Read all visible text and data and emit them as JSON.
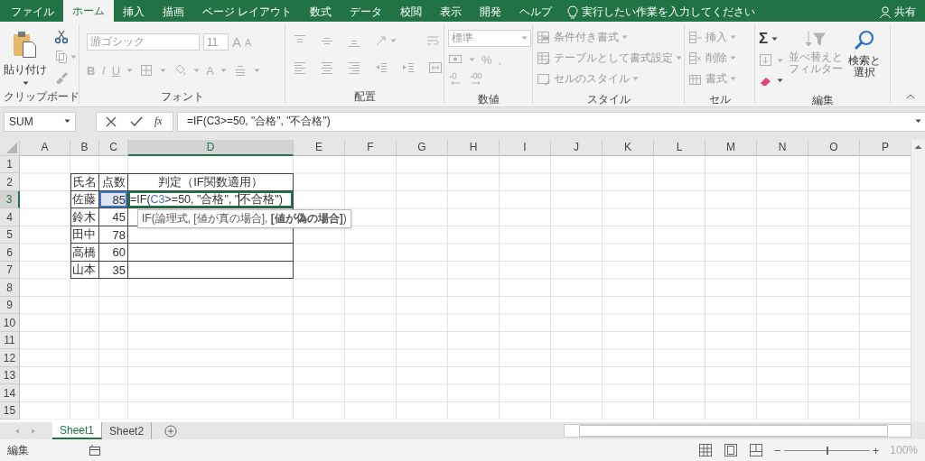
{
  "ribbon_tabs": [
    {
      "label": "ファイル",
      "selected": false
    },
    {
      "label": "ホーム",
      "selected": true
    },
    {
      "label": "挿入",
      "selected": false
    },
    {
      "label": "描画",
      "selected": false
    },
    {
      "label": "ページ レイアウト",
      "selected": false
    },
    {
      "label": "数式",
      "selected": false
    },
    {
      "label": "データ",
      "selected": false
    },
    {
      "label": "校閲",
      "selected": false
    },
    {
      "label": "表示",
      "selected": false
    },
    {
      "label": "開発",
      "selected": false
    },
    {
      "label": "ヘルプ",
      "selected": false
    }
  ],
  "tell_me": "実行したい作業を入力してください",
  "share": "共有",
  "clipboard": {
    "paste": "貼り付け",
    "label": "クリップボード"
  },
  "font": {
    "disabled": true,
    "name": "游ゴシック",
    "size": "11",
    "grow": "A",
    "shrink": "A",
    "bold": "B",
    "italic": "I",
    "underline": "U",
    "font_color": "A",
    "label": "フォント"
  },
  "alignment": {
    "disabled": true,
    "label": "配置"
  },
  "number": {
    "disabled": true,
    "format": "標準",
    "percent": "%",
    "comma": ",",
    "label": "数値"
  },
  "styles": {
    "disabled": true,
    "items": [
      "条件付き書式",
      "テーブルとして書式設定",
      "セルのスタイル"
    ],
    "label": "スタイル"
  },
  "cells": {
    "disabled": true,
    "items": [
      "挿入",
      "削除",
      "書式"
    ],
    "label": "セル"
  },
  "editing": {
    "autosum": "Σ",
    "sort": {
      "lines": [
        "並べ替えと",
        "フィルター"
      ],
      "disabled": true
    },
    "find": {
      "lines": [
        "検索と",
        "選択"
      ],
      "disabled": false
    },
    "label": "編集"
  },
  "formula_bar": {
    "name_box": "SUM",
    "function_button": "fx",
    "formula": "=IF(C3>=50, \"合格\", \"不合格\")"
  },
  "columns": [
    {
      "label": "A",
      "selected": false
    },
    {
      "label": "B",
      "selected": false
    },
    {
      "label": "C",
      "selected": false
    },
    {
      "label": "D",
      "selected": true
    },
    {
      "label": "E",
      "selected": false
    },
    {
      "label": "F",
      "selected": false
    },
    {
      "label": "G",
      "selected": false
    },
    {
      "label": "H",
      "selected": false
    },
    {
      "label": "I",
      "selected": false
    },
    {
      "label": "J",
      "selected": false
    },
    {
      "label": "K",
      "selected": false
    },
    {
      "label": "L",
      "selected": false
    },
    {
      "label": "M",
      "selected": false
    },
    {
      "label": "N",
      "selected": false
    },
    {
      "label": "O",
      "selected": false
    },
    {
      "label": "P",
      "selected": false
    }
  ],
  "rows": [
    {
      "label": "1",
      "selected": false
    },
    {
      "label": "2",
      "selected": false
    },
    {
      "label": "3",
      "selected": true
    },
    {
      "label": "4",
      "selected": false
    },
    {
      "label": "5",
      "selected": false
    },
    {
      "label": "6",
      "selected": false
    },
    {
      "label": "7",
      "selected": false
    },
    {
      "label": "8",
      "selected": false
    },
    {
      "label": "9",
      "selected": false
    },
    {
      "label": "10",
      "selected": false
    },
    {
      "label": "11",
      "selected": false
    },
    {
      "label": "12",
      "selected": false
    },
    {
      "label": "13",
      "selected": false
    },
    {
      "label": "14",
      "selected": false
    },
    {
      "label": "15",
      "selected": false
    }
  ],
  "table": {
    "header": [
      "氏名",
      "点数",
      "判定（IF関数適用）"
    ],
    "rows": [
      {
        "name": "佐藤",
        "score": "85",
        "referenced": true,
        "editing": true,
        "result_parts": [
          {
            "kind": "plain",
            "text": "=IF("
          },
          {
            "kind": "reference",
            "text": "C3"
          },
          {
            "kind": "plain",
            "text": ">=50, \"合格\", \""
          },
          {
            "kind": "caret"
          },
          {
            "kind": "plain",
            "text": "不合格\")"
          }
        ]
      },
      {
        "name": "鈴木",
        "score": "45",
        "referenced": false,
        "editing": false
      },
      {
        "name": "田中",
        "score": "78",
        "referenced": false,
        "editing": false
      },
      {
        "name": "高橋",
        "score": "60",
        "referenced": false,
        "editing": false
      },
      {
        "name": "山本",
        "score": "35",
        "referenced": false,
        "editing": false
      }
    ]
  },
  "tooltip": "IF(論理式, [値が真の場合], **[値が偽の場合]**)",
  "sheet_tabs": [
    {
      "label": "Sheet1",
      "selected": true
    },
    {
      "label": "Sheet2",
      "selected": false
    }
  ],
  "status_bar": {
    "mode": "編集",
    "zoom": {
      "zoom_out": "−",
      "zoom_in": "+",
      "level": 0.5,
      "reading": "100%"
    }
  }
}
